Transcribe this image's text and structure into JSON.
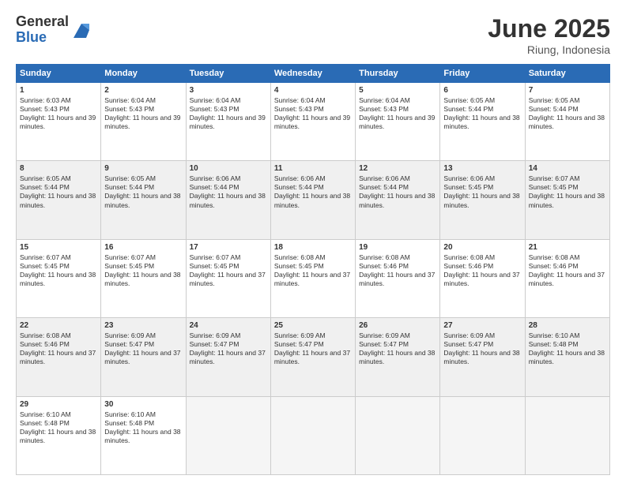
{
  "header": {
    "logo_general": "General",
    "logo_blue": "Blue",
    "month_title": "June 2025",
    "location": "Riung, Indonesia"
  },
  "weekdays": [
    "Sunday",
    "Monday",
    "Tuesday",
    "Wednesday",
    "Thursday",
    "Friday",
    "Saturday"
  ],
  "weeks": [
    [
      {
        "day": "1",
        "sunrise": "6:03 AM",
        "sunset": "5:43 PM",
        "daylight": "11 hours and 39 minutes."
      },
      {
        "day": "2",
        "sunrise": "6:04 AM",
        "sunset": "5:43 PM",
        "daylight": "11 hours and 39 minutes."
      },
      {
        "day": "3",
        "sunrise": "6:04 AM",
        "sunset": "5:43 PM",
        "daylight": "11 hours and 39 minutes."
      },
      {
        "day": "4",
        "sunrise": "6:04 AM",
        "sunset": "5:43 PM",
        "daylight": "11 hours and 39 minutes."
      },
      {
        "day": "5",
        "sunrise": "6:04 AM",
        "sunset": "5:43 PM",
        "daylight": "11 hours and 39 minutes."
      },
      {
        "day": "6",
        "sunrise": "6:05 AM",
        "sunset": "5:44 PM",
        "daylight": "11 hours and 38 minutes."
      },
      {
        "day": "7",
        "sunrise": "6:05 AM",
        "sunset": "5:44 PM",
        "daylight": "11 hours and 38 minutes."
      }
    ],
    [
      {
        "day": "8",
        "sunrise": "6:05 AM",
        "sunset": "5:44 PM",
        "daylight": "11 hours and 38 minutes."
      },
      {
        "day": "9",
        "sunrise": "6:05 AM",
        "sunset": "5:44 PM",
        "daylight": "11 hours and 38 minutes."
      },
      {
        "day": "10",
        "sunrise": "6:06 AM",
        "sunset": "5:44 PM",
        "daylight": "11 hours and 38 minutes."
      },
      {
        "day": "11",
        "sunrise": "6:06 AM",
        "sunset": "5:44 PM",
        "daylight": "11 hours and 38 minutes."
      },
      {
        "day": "12",
        "sunrise": "6:06 AM",
        "sunset": "5:44 PM",
        "daylight": "11 hours and 38 minutes."
      },
      {
        "day": "13",
        "sunrise": "6:06 AM",
        "sunset": "5:45 PM",
        "daylight": "11 hours and 38 minutes."
      },
      {
        "day": "14",
        "sunrise": "6:07 AM",
        "sunset": "5:45 PM",
        "daylight": "11 hours and 38 minutes."
      }
    ],
    [
      {
        "day": "15",
        "sunrise": "6:07 AM",
        "sunset": "5:45 PM",
        "daylight": "11 hours and 38 minutes."
      },
      {
        "day": "16",
        "sunrise": "6:07 AM",
        "sunset": "5:45 PM",
        "daylight": "11 hours and 38 minutes."
      },
      {
        "day": "17",
        "sunrise": "6:07 AM",
        "sunset": "5:45 PM",
        "daylight": "11 hours and 37 minutes."
      },
      {
        "day": "18",
        "sunrise": "6:08 AM",
        "sunset": "5:45 PM",
        "daylight": "11 hours and 37 minutes."
      },
      {
        "day": "19",
        "sunrise": "6:08 AM",
        "sunset": "5:46 PM",
        "daylight": "11 hours and 37 minutes."
      },
      {
        "day": "20",
        "sunrise": "6:08 AM",
        "sunset": "5:46 PM",
        "daylight": "11 hours and 37 minutes."
      },
      {
        "day": "21",
        "sunrise": "6:08 AM",
        "sunset": "5:46 PM",
        "daylight": "11 hours and 37 minutes."
      }
    ],
    [
      {
        "day": "22",
        "sunrise": "6:08 AM",
        "sunset": "5:46 PM",
        "daylight": "11 hours and 37 minutes."
      },
      {
        "day": "23",
        "sunrise": "6:09 AM",
        "sunset": "5:47 PM",
        "daylight": "11 hours and 37 minutes."
      },
      {
        "day": "24",
        "sunrise": "6:09 AM",
        "sunset": "5:47 PM",
        "daylight": "11 hours and 37 minutes."
      },
      {
        "day": "25",
        "sunrise": "6:09 AM",
        "sunset": "5:47 PM",
        "daylight": "11 hours and 37 minutes."
      },
      {
        "day": "26",
        "sunrise": "6:09 AM",
        "sunset": "5:47 PM",
        "daylight": "11 hours and 38 minutes."
      },
      {
        "day": "27",
        "sunrise": "6:09 AM",
        "sunset": "5:47 PM",
        "daylight": "11 hours and 38 minutes."
      },
      {
        "day": "28",
        "sunrise": "6:10 AM",
        "sunset": "5:48 PM",
        "daylight": "11 hours and 38 minutes."
      }
    ],
    [
      {
        "day": "29",
        "sunrise": "6:10 AM",
        "sunset": "5:48 PM",
        "daylight": "11 hours and 38 minutes."
      },
      {
        "day": "30",
        "sunrise": "6:10 AM",
        "sunset": "5:48 PM",
        "daylight": "11 hours and 38 minutes."
      },
      null,
      null,
      null,
      null,
      null
    ]
  ]
}
